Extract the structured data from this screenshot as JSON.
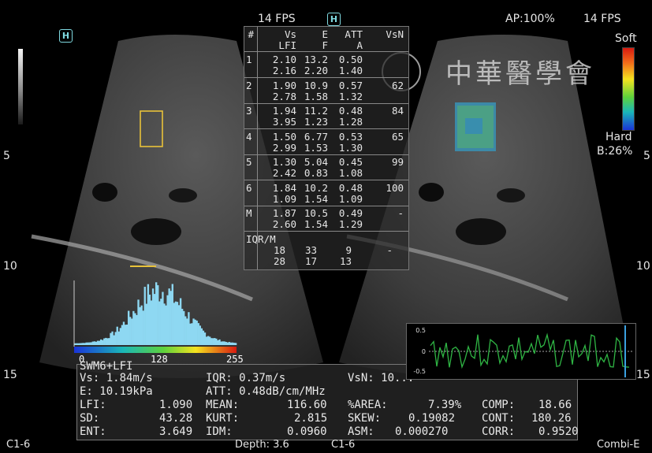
{
  "header": {
    "fps_left": "14 FPS",
    "fps_right": "14 FPS",
    "ap": "AP:100%",
    "h_badge": "H"
  },
  "elasto_scale": {
    "top_label": "Soft",
    "bottom_label": "Hard",
    "b_label": "B:26%"
  },
  "depth_marks": {
    "left": [
      "5",
      "10",
      "15"
    ],
    "right": [
      "5",
      "10",
      "15"
    ]
  },
  "watermark": {
    "text": "中華醫學會"
  },
  "table": {
    "headers": [
      "#",
      "Vs",
      "E",
      "ATT",
      "VsN"
    ],
    "subheaders": [
      "LFI",
      "F",
      "A"
    ],
    "rows": [
      {
        "id": "1",
        "vs": "2.10",
        "e": "13.2",
        "att": "0.50",
        "vsn": "",
        "lfi": "2.16",
        "f": "2.20",
        "a": "1.40"
      },
      {
        "id": "2",
        "vs": "1.90",
        "e": "10.9",
        "att": "0.57",
        "vsn": "62",
        "lfi": "2.78",
        "f": "1.58",
        "a": "1.32"
      },
      {
        "id": "3",
        "vs": "1.94",
        "e": "11.2",
        "att": "0.48",
        "vsn": "84",
        "lfi": "3.95",
        "f": "1.23",
        "a": "1.28"
      },
      {
        "id": "4",
        "vs": "1.50",
        "e": "6.77",
        "att": "0.53",
        "vsn": "65",
        "lfi": "2.99",
        "f": "1.53",
        "a": "1.30"
      },
      {
        "id": "5",
        "vs": "1.30",
        "e": "5.04",
        "att": "0.45",
        "vsn": "99",
        "lfi": "2.42",
        "f": "0.83",
        "a": "1.08"
      },
      {
        "id": "6",
        "vs": "1.84",
        "e": "10.2",
        "att": "0.48",
        "vsn": "100",
        "lfi": "1.09",
        "f": "1.54",
        "a": "1.09"
      },
      {
        "id": "M",
        "vs": "1.87",
        "e": "10.5",
        "att": "0.49",
        "vsn": "-",
        "lfi": "2.60",
        "f": "1.54",
        "a": "1.29"
      }
    ],
    "iqr": {
      "label": "IQR/M",
      "r1": [
        "18",
        "33",
        "9",
        "-"
      ],
      "r2": [
        "28",
        "17",
        "13"
      ]
    }
  },
  "histogram": {
    "axis_ticks": [
      "0",
      "128",
      "255"
    ],
    "mode_label": "SWM6+LFI"
  },
  "stats": {
    "line1": {
      "vs": "Vs:  1.84m/s",
      "iqr": "IQR:  0.37m/s",
      "vsn": "VsN: 10..."
    },
    "line2": {
      "e": "E:  10.19kPa",
      "att": "ATT:  0.48dB/cm/MHz"
    },
    "line3": {
      "lfi_k": "LFI:",
      "lfi_v": "1.090",
      "mean_k": "MEAN:",
      "mean_v": "116.60",
      "area_k": "%AREA:",
      "area_v": "7.39%",
      "comp_k": "COMP:",
      "comp_v": "18.66"
    },
    "line4": {
      "sd_k": "SD:",
      "sd_v": "43.28",
      "kurt_k": "KURT:",
      "kurt_v": "2.815",
      "skew_k": "SKEW:",
      "skew_v": "0.19082",
      "cont_k": "CONT:",
      "cont_v": "180.26"
    },
    "line5": {
      "ent_k": "ENT:",
      "ent_v": "3.649",
      "idm_k": "IDM:",
      "idm_v": "0.0960",
      "asm_k": "ASM:",
      "asm_v": "0.000270",
      "corr_k": "CORR:",
      "corr_v": "0.9520"
    }
  },
  "waveform": {
    "ticks": [
      "0.5",
      "0",
      "-0.5"
    ]
  },
  "footer": {
    "probe_left": "C1-6",
    "depth": "Depth: 3.6",
    "probe_mid": "C1-6",
    "mode": "Combi-E"
  }
}
